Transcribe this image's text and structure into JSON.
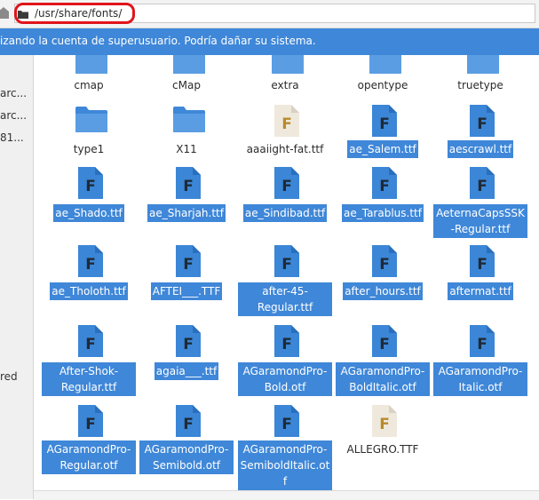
{
  "location": {
    "path": "/usr/share/fonts/"
  },
  "banner": {
    "text": "izando la cuenta de superusuario. Podría dañar su sistema."
  },
  "sidebar": {
    "items": [
      "arc...",
      "arc...",
      "81...",
      "red"
    ]
  },
  "files": [
    {
      "name": "cmap",
      "type": "folder",
      "selected": false
    },
    {
      "name": "cMap",
      "type": "folder",
      "selected": false
    },
    {
      "name": "extra",
      "type": "folder",
      "selected": false
    },
    {
      "name": "opentype",
      "type": "folder",
      "selected": false
    },
    {
      "name": "truetype",
      "type": "folder",
      "selected": false
    },
    {
      "name": "type1",
      "type": "folder",
      "selected": false
    },
    {
      "name": "X11",
      "type": "folder",
      "selected": false
    },
    {
      "name": "aaaiight-fat.ttf",
      "type": "font-file",
      "selected": false
    },
    {
      "name": "ae_Salem.ttf",
      "type": "font-file",
      "selected": true
    },
    {
      "name": "aescrawl.ttf",
      "type": "font-file",
      "selected": true
    },
    {
      "name": "ae_Shado.ttf",
      "type": "font-file",
      "selected": true
    },
    {
      "name": "ae_Sharjah.ttf",
      "type": "font-file",
      "selected": true
    },
    {
      "name": "ae_Sindibad.ttf",
      "type": "font-file",
      "selected": true
    },
    {
      "name": "ae_Tarablus.ttf",
      "type": "font-file",
      "selected": true
    },
    {
      "name": "AeternaCapsSSK-Regular.ttf",
      "type": "font-file",
      "selected": true
    },
    {
      "name": "ae_Tholoth.ttf",
      "type": "font-file",
      "selected": true
    },
    {
      "name": "AFTEI___.TTF",
      "type": "font-file",
      "selected": true
    },
    {
      "name": "after-45-Regular.ttf",
      "type": "font-file",
      "selected": true
    },
    {
      "name": "after_hours.ttf",
      "type": "font-file",
      "selected": true
    },
    {
      "name": "aftermat.ttf",
      "type": "font-file",
      "selected": true
    },
    {
      "name": "After-Shok-Regular.ttf",
      "type": "font-file",
      "selected": true
    },
    {
      "name": "agaia___.ttf",
      "type": "font-file",
      "selected": true
    },
    {
      "name": "AGaramondPro-Bold.otf",
      "type": "font-file",
      "selected": true
    },
    {
      "name": "AGaramondPro-BoldItalic.otf",
      "type": "font-file",
      "selected": true
    },
    {
      "name": "AGaramondPro-Italic.otf",
      "type": "font-file",
      "selected": true
    },
    {
      "name": "AGaramondPro-Regular.otf",
      "type": "font-file",
      "selected": true
    },
    {
      "name": "AGaramondPro-Semibold.otf",
      "type": "font-file",
      "selected": true
    },
    {
      "name": "AGaramondPro-SemiboldItalic.otf",
      "type": "font-file",
      "selected": true
    },
    {
      "name": "ALLEGRO.TTF",
      "type": "font-file",
      "selected": false
    }
  ],
  "colors": {
    "selection": "#3f87d8",
    "folder": "#3f87d8",
    "font_icon_selected": "#3b86d6",
    "font_icon_plain": "#efe9dd",
    "font_letter_plain": "#b88a2c",
    "annotation_circle": "#e0141b"
  },
  "icons": {
    "location_bar_left": "home-icon",
    "path_prefix": "folder-icon",
    "folder": "folder-icon",
    "font_file": "font-file-icon"
  }
}
